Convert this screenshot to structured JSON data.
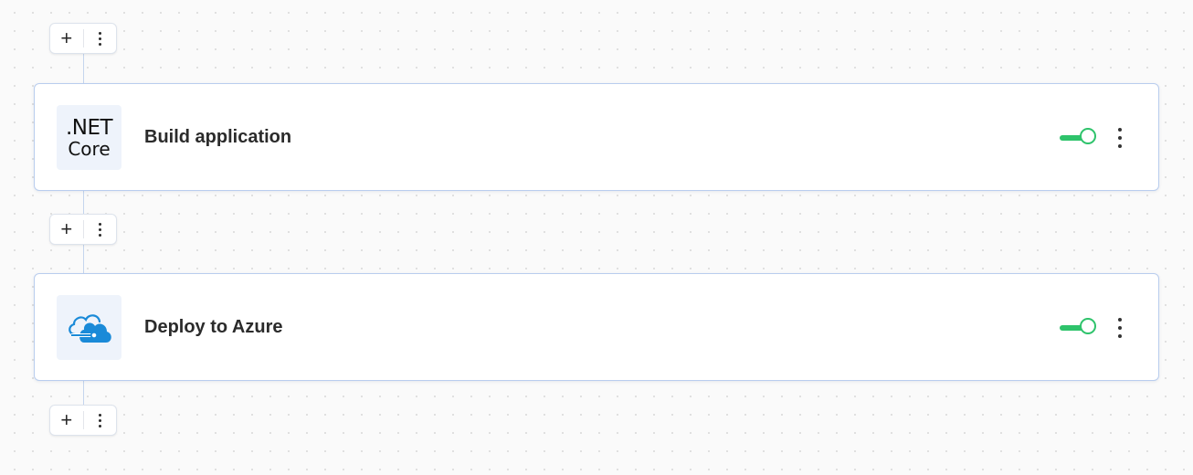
{
  "pipeline": {
    "insert_controls": [
      {
        "add_symbol": "+"
      },
      {
        "add_symbol": "+"
      },
      {
        "add_symbol": "+"
      }
    ],
    "steps": [
      {
        "title": "Build application",
        "icon": "dotnet-core-logo",
        "icon_text_line1": ".NET",
        "icon_text_line2": "Core",
        "enabled": true
      },
      {
        "title": "Deploy to Azure",
        "icon": "azure-cloud-icon",
        "enabled": true
      }
    ]
  },
  "colors": {
    "toggle_on": "#2ec36b",
    "card_border": "#b9cdee",
    "azure_blue": "#1a8ad8",
    "icon_bg": "#eef3fb"
  }
}
